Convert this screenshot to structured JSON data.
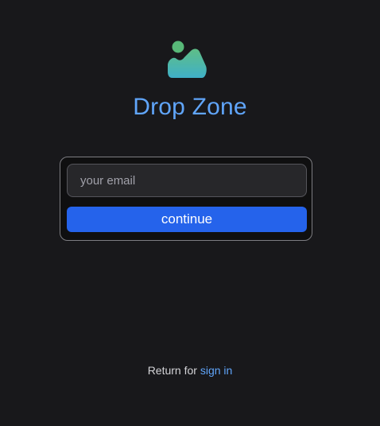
{
  "app": {
    "title": "Drop Zone",
    "logo_icon": "image-landscape-icon"
  },
  "form": {
    "email_placeholder": "your email",
    "email_value": "",
    "continue_label": "continue"
  },
  "footer": {
    "prefix": "Return for",
    "link_label": "sign in"
  },
  "colors": {
    "background": "#18181b",
    "accent": "#60a5fa",
    "button": "#2563eb",
    "logo_gradient_start": "#4ade80",
    "logo_gradient_end": "#38bdf8"
  }
}
